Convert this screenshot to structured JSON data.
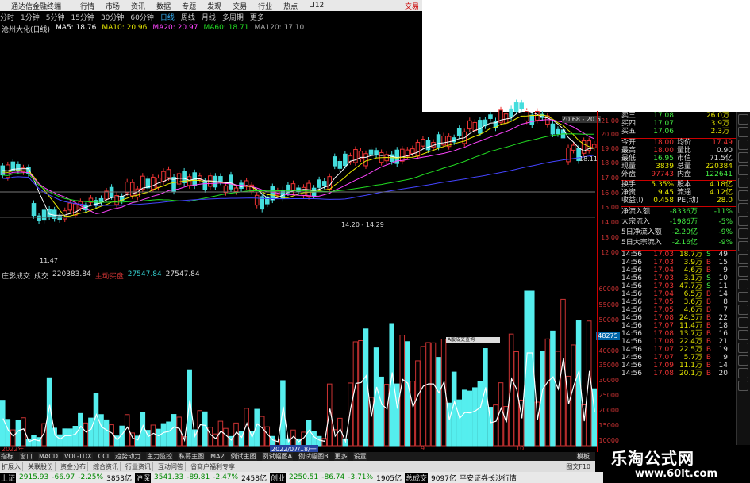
{
  "window": {
    "title": "通达信金融终端",
    "menu": [
      "行情",
      "市场",
      "资讯",
      "数据",
      "专题",
      "发现",
      "交易",
      "行业",
      "热点",
      "LI12"
    ],
    "right_label": "交易"
  },
  "toolbar": {
    "items": [
      "分时",
      "1分钟",
      "5分钟",
      "15分钟",
      "30分钟",
      "60分钟",
      "日线",
      "周线",
      "月线",
      "多周期",
      "更多"
    ],
    "active": "日线"
  },
  "ma_legend": {
    "stock": "沧州大化(日线)",
    "ma5": "MA5: 18.76",
    "ma10": "MA10: 20.96",
    "ma20": "MA20: 20.97",
    "ma60": "MA60: 18.71",
    "ma120": "MA120: 17.10",
    "colors": {
      "ma5": "#ffffff",
      "ma10": "#e8e800",
      "ma20": "#ff44ff",
      "ma60": "#22dd22",
      "ma120": "#aaaaaa"
    }
  },
  "price_labels": {
    "low": "11.47",
    "mid": "14.20 - 14.29",
    "high": "20.68 - 20.6",
    "last": "18.11",
    "y_ticks": [
      "21.00",
      "20.00",
      "19.00",
      "18.00",
      "17.00",
      "16.00",
      "15.00",
      "14.00",
      "13.00",
      "12.00"
    ]
  },
  "vol_legend": {
    "name": "庄影成交",
    "label": "成交",
    "v1": "220383.84",
    "v2": "主动买盘",
    "v3": "27547.84",
    "v4": "27547.84"
  },
  "vol_axis": {
    "ticks": [
      "60000",
      "55000",
      "50000",
      "45000",
      "40000",
      "35000",
      "30000",
      "25000",
      "20000",
      "15000",
      "10000",
      "5000"
    ],
    "tag": "48275"
  },
  "tooltip": "A股成交查询",
  "x_axis": {
    "year": "2022年",
    "date": "2022/07/18/一",
    "m9": "9",
    "m10": "10"
  },
  "quote_panel": {
    "rows": [
      {
        "label": "卖三",
        "v": "17.08",
        "n": "26.0万"
      },
      {
        "label": "买四",
        "v": "17.07",
        "n": "3.9万"
      },
      {
        "label": "买五",
        "v": "17.06",
        "n": "2.3万"
      }
    ],
    "stats": [
      {
        "a": "今开",
        "b": "18.00",
        "c": "均价",
        "d": "17.49"
      },
      {
        "a": "最高",
        "b": "18.00",
        "c": "量比",
        "d": "0.90"
      },
      {
        "a": "最低",
        "b": "16.95",
        "c": "市值",
        "d": "71.5亿"
      },
      {
        "a": "现量",
        "b": "3839",
        "c": "总量",
        "d": "220384"
      },
      {
        "a": "外盘",
        "b": "97743",
        "c": "内盘",
        "d": "122641"
      },
      {
        "a": "换手",
        "b": "5.35%",
        "c": "股本",
        "d": "4.18亿"
      },
      {
        "a": "净资",
        "b": "9.45",
        "c": "流通",
        "d": "4.12亿"
      },
      {
        "a": "收益(I)",
        "b": "0.458",
        "c": "PE(动)",
        "d": "28.0"
      }
    ],
    "flows": [
      {
        "a": "净流入额",
        "b": "-8336万",
        "c": "-11%"
      },
      {
        "a": "大宗流入",
        "b": "-1986万",
        "c": "-5%"
      },
      {
        "a": "5日净流入额",
        "b": "-2.20亿",
        "c": "-9%"
      },
      {
        "a": "5日大宗流入",
        "b": "-2.16亿",
        "c": "-9%"
      }
    ],
    "ticks": [
      {
        "t": "14:56",
        "p": "17.03",
        "v": "18.7万",
        "f": "S",
        "n": "49"
      },
      {
        "t": "14:56",
        "p": "17.03",
        "v": "3.9万",
        "f": "B",
        "n": "15"
      },
      {
        "t": "14:56",
        "p": "17.04",
        "v": "4.6万",
        "f": "B",
        "n": "9"
      },
      {
        "t": "14:56",
        "p": "17.03",
        "v": "3.1万",
        "f": "S",
        "n": "10"
      },
      {
        "t": "14:56",
        "p": "17.03",
        "v": "47.7万",
        "f": "S",
        "n": "11"
      },
      {
        "t": "14:56",
        "p": "17.04",
        "v": "6.5万",
        "f": "B",
        "n": "14"
      },
      {
        "t": "14:56",
        "p": "17.05",
        "v": "3.6万",
        "f": "B",
        "n": "8"
      },
      {
        "t": "14:56",
        "p": "17.05",
        "v": "4.6万",
        "f": "B",
        "n": "7"
      },
      {
        "t": "14:56",
        "p": "17.08",
        "v": "24.3万",
        "f": "B",
        "n": "22"
      },
      {
        "t": "14:56",
        "p": "17.07",
        "v": "11.4万",
        "f": "B",
        "n": "18"
      },
      {
        "t": "14:56",
        "p": "17.08",
        "v": "13.7万",
        "f": "B",
        "n": "16"
      },
      {
        "t": "14:56",
        "p": "17.08",
        "v": "22.4万",
        "f": "B",
        "n": "21"
      },
      {
        "t": "14:56",
        "p": "17.07",
        "v": "22.5万",
        "f": "B",
        "n": "19"
      },
      {
        "t": "14:56",
        "p": "17.07",
        "v": "5.7万",
        "f": "B",
        "n": "9"
      },
      {
        "t": "14:56",
        "p": "17.09",
        "v": "11.1万",
        "f": "B",
        "n": "14"
      },
      {
        "t": "14:56",
        "p": "17.08",
        "v": "20.1万",
        "f": "B",
        "n": "20"
      }
    ]
  },
  "indicator_tabs": [
    "指标",
    "窗口",
    "MACD",
    "VOL-TDX",
    "CCI",
    "趋势动力",
    "主力监控",
    "私募主图",
    "MA2",
    "例试主图",
    "例试幅图A",
    "例试幅图B",
    "更多",
    "设置"
  ],
  "indicator_right": "模板",
  "tabs2": [
    "扩展入",
    "关联股份",
    "资金分布",
    "综合资讯",
    "行业资讯",
    "互动问答",
    "省商户福利专享"
  ],
  "statusbar": {
    "sh": "上证",
    "sh_v": "2915.93",
    "sh_c": "-66.97",
    "sh_p": "-2.25%",
    "sh_a": "3853亿",
    "sz": "沪深",
    "sz_v": "3541.33",
    "sz_c": "-89.81",
    "sz_p": "-2.47%",
    "sz_a": "2458亿",
    "cy": "创业",
    "cy_v": "2250.51",
    "cy_c": "-86.74",
    "cy_p": "-3.71%",
    "cy_a": "1905亿",
    "total": "总成交",
    "total_v": "9097亿",
    "broker": "平安证券长沙行情"
  },
  "watermark": {
    "cn": "乐淘公式网",
    "url": "www.60lt.com"
  },
  "misc": {
    "right_status": "图文F10"
  }
}
